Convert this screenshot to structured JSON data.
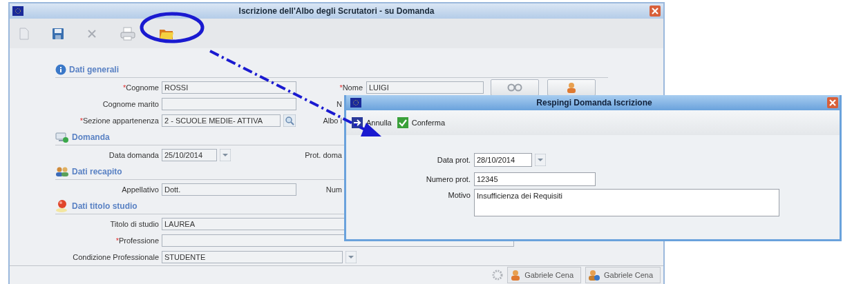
{
  "window": {
    "title": "Iscrizione dell'Albo degli Scrutatori - su Domanda"
  },
  "sections": [
    {
      "title": "Dati generali",
      "rows": [
        {
          "left": {
            "label": "Cognome",
            "mark": "*",
            "value": "ROSSI",
            "kind": "text"
          },
          "right": {
            "label": "Nome",
            "mark": "*",
            "value": "LUIGI"
          }
        },
        {
          "left": {
            "label": "Cognome marito",
            "kind": "text"
          },
          "right": {
            "label": "N"
          }
        },
        {
          "left": {
            "label": "Sezione appartenenza",
            "mark": "*",
            "value": "2 - SCUOLE MEDIE- ATTIVA",
            "kind": "lookup"
          },
          "right": {
            "label": "Albo i"
          }
        }
      ]
    },
    {
      "title": "Domanda",
      "rows": [
        {
          "left": {
            "label": "Data domanda",
            "value": "25/10/2014",
            "kind": "date"
          },
          "right": {
            "label": "Prot. doma"
          }
        }
      ]
    },
    {
      "title": "Dati recapito",
      "rows": [
        {
          "left": {
            "label": "Appellativo",
            "value": "Dott.",
            "kind": "text"
          },
          "right": {
            "label": "Num"
          }
        }
      ]
    },
    {
      "title": "Dati titolo studio",
      "rows": [
        {
          "left": {
            "label": "Titolo di studio",
            "value": "LAUREA",
            "kind": "wide"
          }
        },
        {
          "left": {
            "label": "Professione",
            "mark": "*",
            "kind": "wide"
          }
        },
        {
          "left": {
            "label": "Condizione Professionale",
            "value": "STUDENTE",
            "kind": "select"
          }
        }
      ]
    }
  ],
  "status_bar": {
    "users": [
      {
        "name": "Gabriele Cena"
      },
      {
        "name": "Gabriele Cena"
      }
    ]
  },
  "dialog": {
    "title": "Respingi Domanda Iscrizione",
    "buttons": [
      {
        "label": "Annulla",
        "kind": "cancel"
      },
      {
        "label": "Conferma",
        "kind": "confirm"
      }
    ],
    "fields": [
      {
        "label": "Data prot.",
        "value": "28/10/2014",
        "kind": "date"
      },
      {
        "label": "Numero prot.",
        "value": "12345",
        "kind": "text"
      },
      {
        "label": "Motivo",
        "value": "Insufficienza dei Requisiti",
        "kind": "textarea"
      }
    ]
  }
}
